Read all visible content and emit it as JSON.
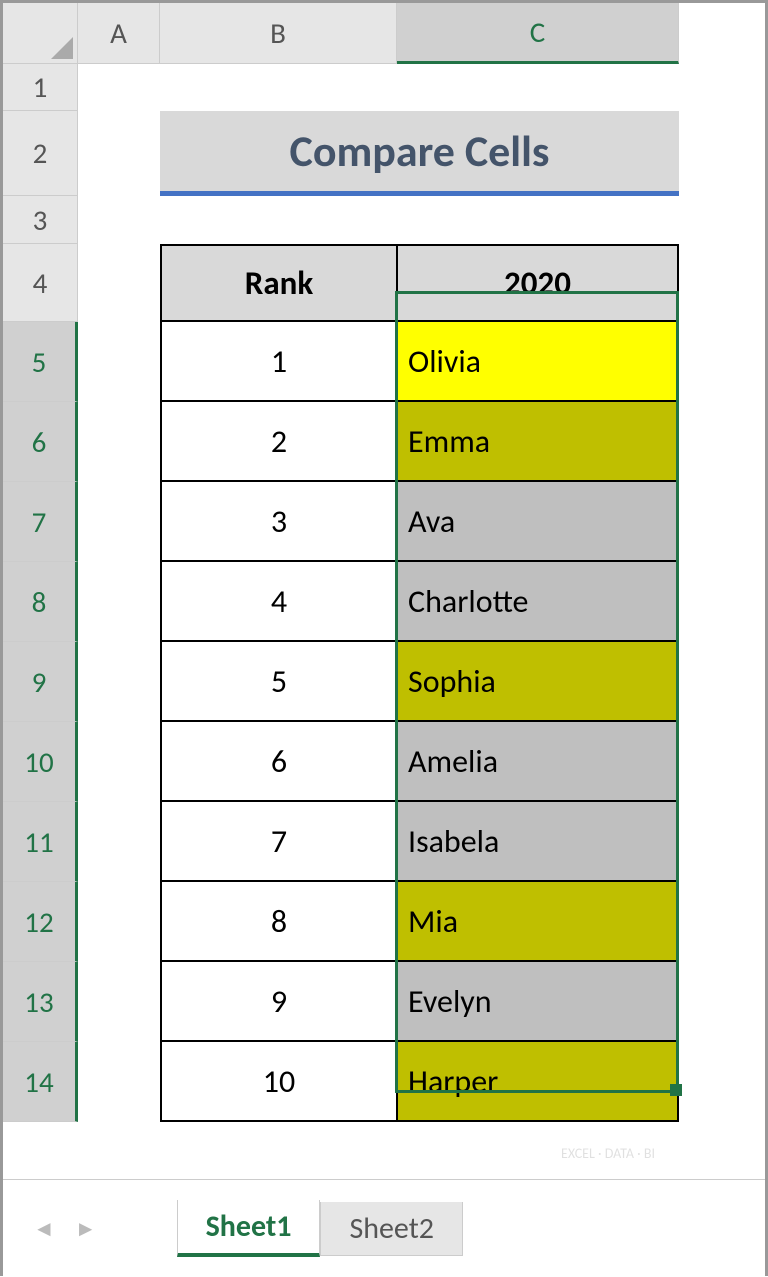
{
  "columns": [
    "A",
    "B",
    "C"
  ],
  "rows": [
    "1",
    "2",
    "3",
    "4",
    "5",
    "6",
    "7",
    "8",
    "9",
    "10",
    "11",
    "12",
    "13",
    "14"
  ],
  "title": "Compare Cells",
  "headers": {
    "rank": "Rank",
    "year": "2020"
  },
  "data": [
    {
      "rank": "1",
      "name": "Olivia",
      "bg": "bg-yellow"
    },
    {
      "rank": "2",
      "name": "Emma",
      "bg": "bg-olive"
    },
    {
      "rank": "3",
      "name": "Ava",
      "bg": "bg-gray"
    },
    {
      "rank": "4",
      "name": "Charlotte",
      "bg": "bg-gray"
    },
    {
      "rank": "5",
      "name": "Sophia",
      "bg": "bg-olive"
    },
    {
      "rank": "6",
      "name": "Amelia",
      "bg": "bg-gray"
    },
    {
      "rank": "7",
      "name": "Isabela",
      "bg": "bg-gray"
    },
    {
      "rank": "8",
      "name": "Mia",
      "bg": "bg-olive"
    },
    {
      "rank": "9",
      "name": "Evelyn",
      "bg": "bg-gray"
    },
    {
      "rank": "10",
      "name": "Harper",
      "bg": "bg-olive"
    }
  ],
  "tabs": {
    "active": "Sheet1",
    "inactive": "Sheet2"
  },
  "selected": {
    "col": "C",
    "rows_from": 5,
    "rows_to": 14
  }
}
